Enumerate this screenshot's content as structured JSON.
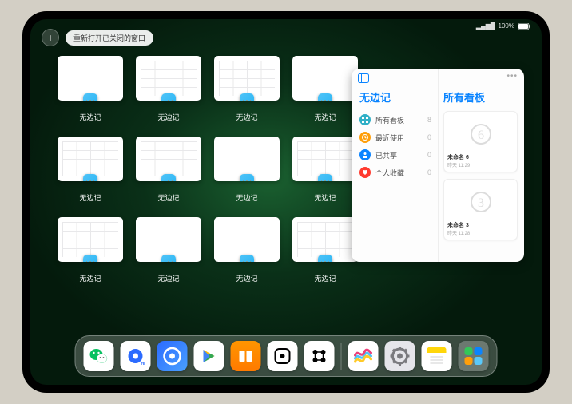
{
  "status": {
    "battery": "100%",
    "signal": "●●●●"
  },
  "topbar": {
    "plus": "+",
    "reopen_label": "重新打开已关闭的窗口"
  },
  "windows": {
    "app_label": "无边记",
    "items": [
      {
        "type": "blank"
      },
      {
        "type": "board"
      },
      {
        "type": "board"
      },
      {
        "type": "blank"
      },
      {
        "type": "board"
      },
      {
        "type": "board"
      },
      {
        "type": "blank"
      },
      {
        "type": "board"
      },
      {
        "type": "board"
      },
      {
        "type": "blank"
      },
      {
        "type": "blank"
      },
      {
        "type": "board"
      }
    ]
  },
  "panel": {
    "left_title": "无边记",
    "right_title": "所有看板",
    "rows": [
      {
        "icon": "grid",
        "color": "#30b0c7",
        "label": "所有看板",
        "count": "8"
      },
      {
        "icon": "clock",
        "color": "#ff9f0a",
        "label": "最近使用",
        "count": "0"
      },
      {
        "icon": "people",
        "color": "#0a84ff",
        "label": "已共享",
        "count": "0"
      },
      {
        "icon": "heart",
        "color": "#ff3b30",
        "label": "个人收藏",
        "count": "0"
      }
    ],
    "boards": [
      {
        "sketch": "6",
        "title": "未命名 6",
        "time": "昨天 11:29"
      },
      {
        "sketch": "3",
        "title": "未命名 3",
        "time": "昨天 11:28"
      }
    ]
  },
  "dock": {
    "main": [
      {
        "name": "wechat",
        "bg": "#fff",
        "glyph": "weixin"
      },
      {
        "name": "quark-cam",
        "bg": "#fff",
        "glyph": "quark-blue"
      },
      {
        "name": "quark",
        "bg": "linear-gradient(135deg,#2b6bff,#4aa0ff)",
        "glyph": "quark-white"
      },
      {
        "name": "play",
        "bg": "#fff",
        "glyph": "play"
      },
      {
        "name": "books",
        "bg": "linear-gradient(#ff9500,#ff7a00)",
        "glyph": "books"
      },
      {
        "name": "dice",
        "bg": "#fff",
        "glyph": "dice"
      },
      {
        "name": "connect",
        "bg": "#fff",
        "glyph": "connect"
      }
    ],
    "recent": [
      {
        "name": "freeform",
        "bg": "#fff",
        "glyph": "freeform"
      },
      {
        "name": "settings",
        "bg": "#e5e5ea",
        "glyph": "gear"
      },
      {
        "name": "notes",
        "bg": "#fff",
        "glyph": "notes"
      },
      {
        "name": "app-library",
        "bg": "rgba(255,255,255,0.25)",
        "glyph": "library"
      }
    ]
  }
}
